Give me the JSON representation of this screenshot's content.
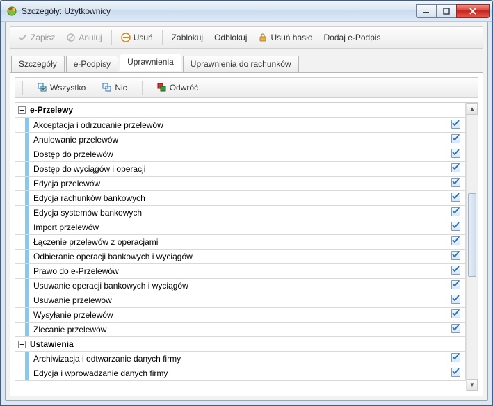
{
  "window": {
    "title": "Szczegóły: Użytkownicy"
  },
  "toolbar": {
    "save": "Zapisz",
    "cancel": "Anuluj",
    "delete": "Usuń",
    "block": "Zablokuj",
    "unblock": "Odblokuj",
    "del_password": "Usuń hasło",
    "add_esign": "Dodaj e-Podpis"
  },
  "tabs": {
    "details": "Szczegóły",
    "esign": "e-Podpisy",
    "perms": "Uprawnienia",
    "acct_perms": "Uprawnienia do rachunków"
  },
  "sel": {
    "all": "Wszystko",
    "none": "Nic",
    "invert": "Odwróć"
  },
  "groups": [
    {
      "name": "e-Przelewy",
      "items": [
        {
          "label": "Akceptacja i odrzucanie przelewów",
          "checked": true
        },
        {
          "label": "Anulowanie przelewów",
          "checked": true
        },
        {
          "label": "Dostęp do przelewów",
          "checked": true
        },
        {
          "label": "Dostęp do wyciągów i operacji",
          "checked": true
        },
        {
          "label": "Edycja przelewów",
          "checked": true
        },
        {
          "label": "Edycja rachunków bankowych",
          "checked": true
        },
        {
          "label": "Edycja systemów bankowych",
          "checked": true
        },
        {
          "label": "Import przelewów",
          "checked": true
        },
        {
          "label": "Łączenie przelewów z operacjami",
          "checked": true
        },
        {
          "label": "Odbieranie operacji bankowych i wyciągów",
          "checked": true
        },
        {
          "label": "Prawo do e-Przelewów",
          "checked": true
        },
        {
          "label": "Usuwanie operacji bankowych i wyciągów",
          "checked": true
        },
        {
          "label": "Usuwanie przelewów",
          "checked": true
        },
        {
          "label": "Wysyłanie przelewów",
          "checked": true
        },
        {
          "label": "Zlecanie przelewów",
          "checked": true
        }
      ]
    },
    {
      "name": "Ustawienia",
      "items": [
        {
          "label": "Archiwizacja i odtwarzanie danych firmy",
          "checked": true
        },
        {
          "label": "Edycja i wprowadzanie danych firmy",
          "checked": true
        }
      ]
    }
  ]
}
